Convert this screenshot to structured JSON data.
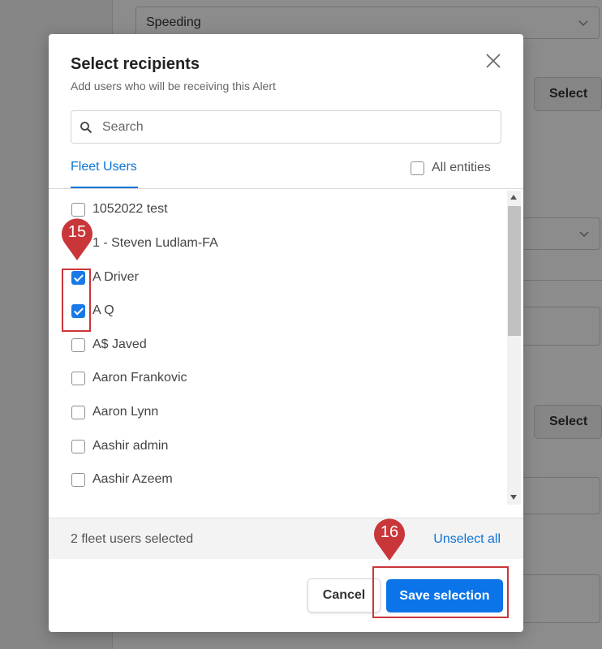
{
  "background": {
    "dropdown_value": "Speeding",
    "select_button_label": "Select"
  },
  "modal": {
    "title": "Select recipients",
    "subtitle": "Add users who will be receiving this Alert",
    "search": {
      "placeholder": "Search",
      "value": ""
    },
    "tab_label": "Fleet Users",
    "all_entities_label": "All entities",
    "all_entities_checked": false,
    "users": [
      {
        "name": "1052022 test",
        "checked": false
      },
      {
        "name": "1 - Steven Ludlam-FA",
        "checked": false
      },
      {
        "name": "A Driver",
        "checked": true
      },
      {
        "name": "A Q",
        "checked": true
      },
      {
        "name": "A$ Javed",
        "checked": false
      },
      {
        "name": "Aaron Frankovic",
        "checked": false
      },
      {
        "name": "Aaron Lynn",
        "checked": false
      },
      {
        "name": "Aashir admin",
        "checked": false
      },
      {
        "name": "Aashir Azeem",
        "checked": false
      }
    ],
    "selected_count_text": "2 fleet users selected",
    "unselect_all_label": "Unselect all",
    "cancel_label": "Cancel",
    "save_label": "Save selection"
  },
  "annotations": {
    "step_a": "15",
    "step_b": "16",
    "color": "#c9363a"
  },
  "colors": {
    "accent": "#0b74d6",
    "primary_button": "#0b74e8",
    "checkbox_checked": "#1979e8"
  }
}
